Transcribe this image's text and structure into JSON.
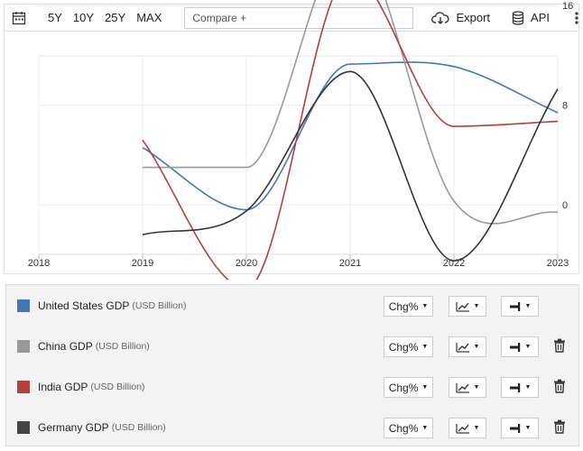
{
  "toolbar": {
    "ranges": [
      "5Y",
      "10Y",
      "25Y",
      "MAX"
    ],
    "compare_placeholder": "Compare +",
    "export_label": "Export",
    "api_label": "API"
  },
  "chart_data": {
    "type": "line",
    "x": [
      2019,
      2020,
      2021,
      2022,
      2023
    ],
    "xticks": [
      2018,
      2019,
      2020,
      2021,
      2022,
      2023
    ],
    "yticks": [
      0,
      8,
      16
    ],
    "ylim": [
      -8,
      20
    ],
    "y_axis_side": "right",
    "series": [
      {
        "name": "United States GDP",
        "color": "#4575b4",
        "values": [
          4.6,
          -0.4,
          11.3,
          11.1,
          7.4
        ]
      },
      {
        "name": "China GDP",
        "color": "#999999",
        "values": [
          3.0,
          3.0,
          21.3,
          0.3,
          -0.6
        ]
      },
      {
        "name": "India GDP",
        "color": "#b2413e",
        "values": [
          5.2,
          -6.7,
          18.5,
          6.3,
          6.7
        ]
      },
      {
        "name": "Germany GDP",
        "color": "#333333",
        "values": [
          -2.4,
          -0.5,
          10.7,
          -4.5,
          9.3
        ]
      }
    ]
  },
  "legend": [
    {
      "name": "United States GDP",
      "units": "(USD Billion)",
      "color": "#4575b4",
      "chg": "Chg%",
      "deletable": false
    },
    {
      "name": "China GDP",
      "units": "(USD Billion)",
      "color": "#999999",
      "chg": "Chg%",
      "deletable": true
    },
    {
      "name": "India GDP",
      "units": "(USD Billion)",
      "color": "#b2413e",
      "chg": "Chg%",
      "deletable": true
    },
    {
      "name": "Germany GDP",
      "units": "(USD Billion)",
      "color": "#444444",
      "chg": "Chg%",
      "deletable": true
    }
  ]
}
